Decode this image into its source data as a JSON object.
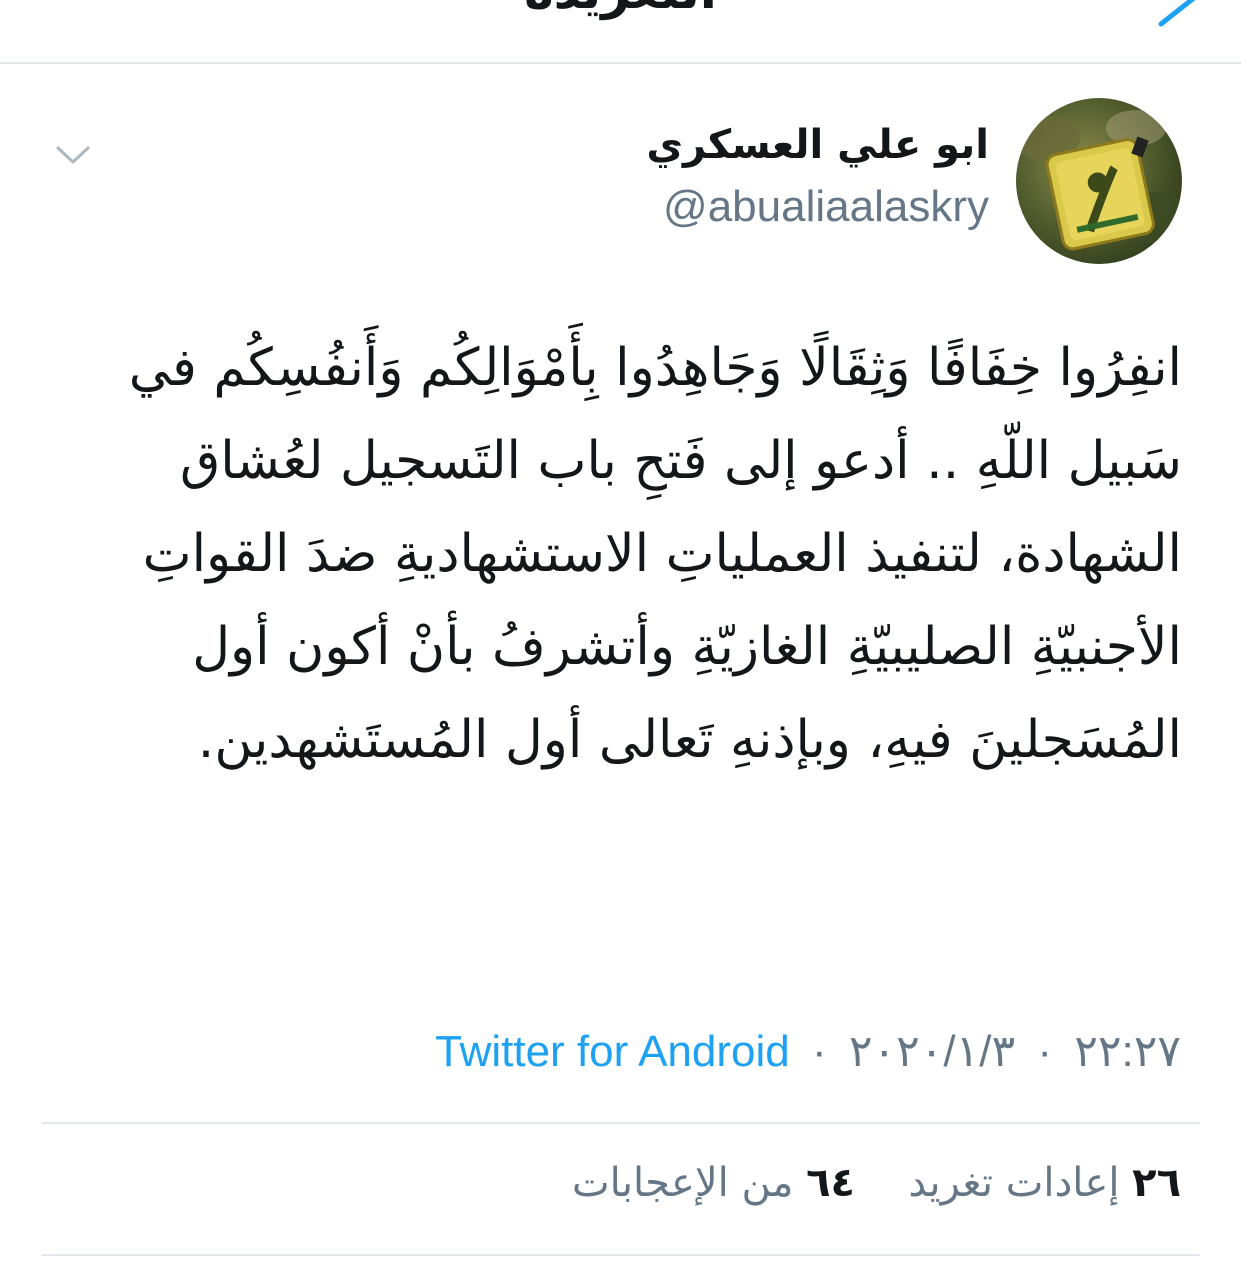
{
  "header": {
    "title": "التغريدة",
    "back_icon": "back-arrow-icon"
  },
  "colors": {
    "accent": "#1da1f2",
    "secondary_text": "#657786",
    "divider": "#e1e8ed"
  },
  "tweet": {
    "author": {
      "display_name": "ابو علي العسكري",
      "handle": "@abualiaalaskry"
    },
    "menu_icon": "chevron-down-icon",
    "text": "انفِرُوا خِفَافًا وَثِقَالًا وَجَاهِدُوا بِأَمْوَالِكُم وَأَنفُسِكُم في سَبيل اللّهِ .. أدعو إلى فَتحِ باب التَسجيل لعُشاق الشهادة، لتنفيذ العملياتِ الاستشهاديةِ ضدَ القواتِ الأجنبيّةِ الصليبيّةِ الغازيّةِ وأتشرفُ بأنْ أكون أول المُسَجلينَ فيهِ، وبإذنهِ تَعالى أول المُستَشهدين.",
    "time": "٢٢:٢٧",
    "date": "٢٠٢٠/١/٣",
    "separator": "·",
    "source": "Twitter for Android",
    "stats": {
      "retweets_count": "٢٦",
      "retweets_label": "إعادات تغريد",
      "likes_count": "٦٤",
      "likes_label": "من الإعجابات"
    }
  }
}
